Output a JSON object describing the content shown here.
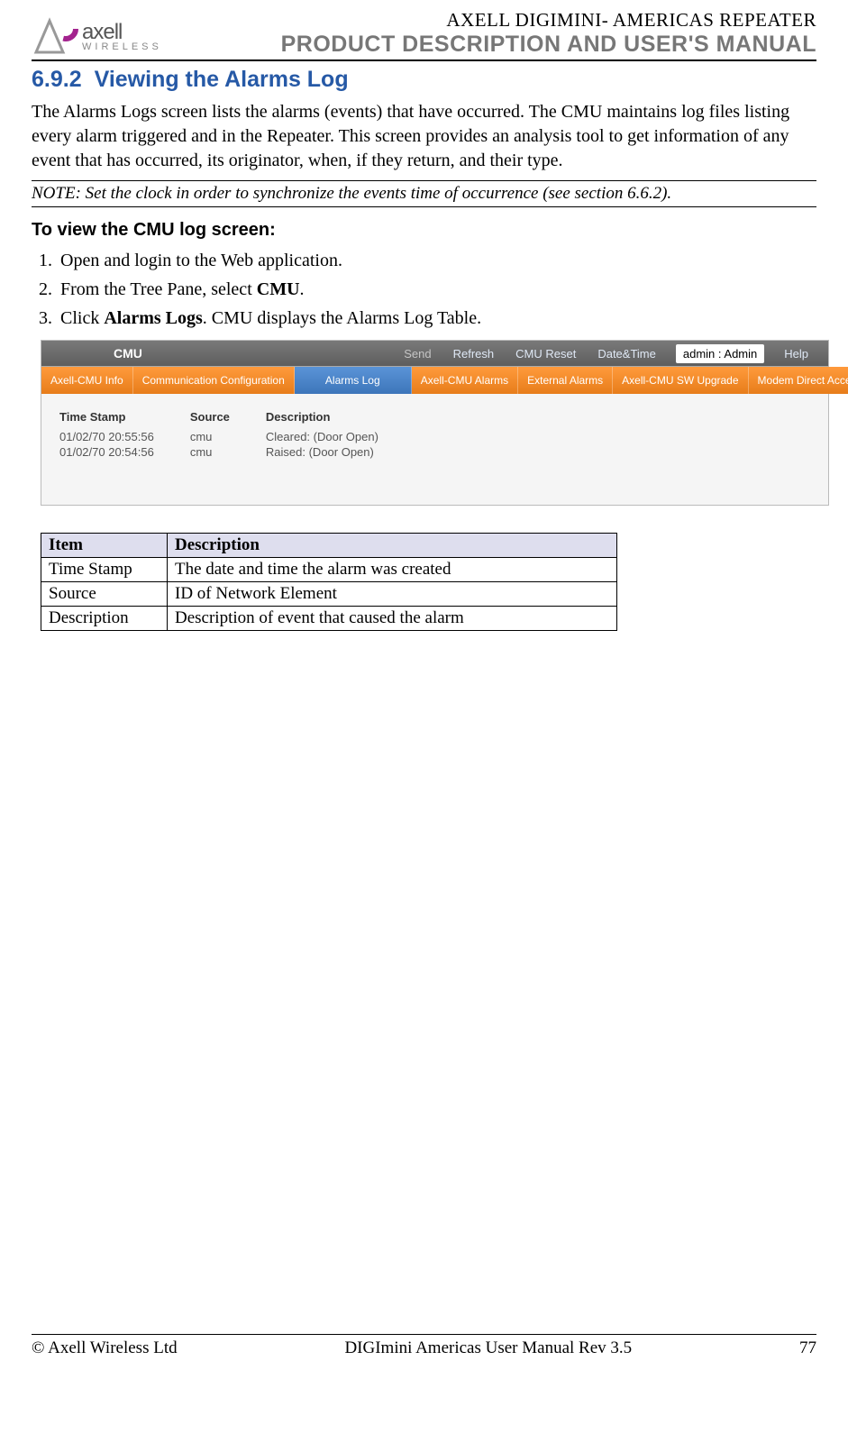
{
  "header": {
    "logo_main": "axell",
    "logo_sub": "WIRELESS",
    "sup_title": "AXELL DIGIMINI- AMERICAS REPEATER",
    "sub_title": "PRODUCT DESCRIPTION AND USER'S MANUAL"
  },
  "section": {
    "number": "6.9.2",
    "title": "Viewing the Alarms Log",
    "intro": "The Alarms Logs screen lists the alarms (events) that have occurred. The CMU maintains log files listing every alarm triggered and in the Repeater. This screen provides an analysis tool to get information of any event that has occurred, its originator, when, if they return, and their type.",
    "note": "NOTE: Set the clock in order to synchronize the events time of occurrence (see section 6.6.2).",
    "sub_heading": "To view the CMU log screen:",
    "steps": [
      {
        "pre": "Open and login to the Web application.",
        "bold": "",
        "post": ""
      },
      {
        "pre": "From the Tree Pane, select ",
        "bold": "CMU",
        "post": "."
      },
      {
        "pre": "Click ",
        "bold": "Alarms Logs",
        "post": ". CMU displays the Alarms Log Table."
      }
    ]
  },
  "screenshot": {
    "topbar": {
      "title": "CMU",
      "links": [
        "Send",
        "Refresh",
        "CMU Reset",
        "Date&Time"
      ],
      "user": "admin : Admin",
      "help": "Help"
    },
    "tabs": [
      {
        "label": "Axell-CMU Info",
        "style": "orange"
      },
      {
        "label": "Communication Configuration",
        "style": "orange"
      },
      {
        "label": "Alarms Log",
        "style": "blue"
      },
      {
        "label": "Axell-CMU Alarms",
        "style": "orange"
      },
      {
        "label": "External Alarms",
        "style": "orange"
      },
      {
        "label": "Axell-CMU SW Upgrade",
        "style": "orange"
      },
      {
        "label": "Modem Direct Access",
        "style": "orange"
      }
    ],
    "columns": [
      "Time Stamp",
      "Source",
      "Description"
    ],
    "rows": [
      {
        "ts": "01/02/70 20:55:56",
        "src": "cmu",
        "desc": "Cleared: (Door Open)"
      },
      {
        "ts": "01/02/70 20:54:56",
        "src": "cmu",
        "desc": "Raised: (Door Open)"
      }
    ]
  },
  "desc_table": {
    "headers": [
      "Item",
      "Description"
    ],
    "rows": [
      [
        "Time Stamp",
        "The date and time the alarm was created"
      ],
      [
        "Source",
        "ID of Network Element"
      ],
      [
        "Description",
        "Description of event that caused the alarm"
      ]
    ]
  },
  "footer": {
    "left": "© Axell Wireless Ltd",
    "center": "DIGImini Americas User Manual Rev 3.5",
    "right": "77"
  }
}
